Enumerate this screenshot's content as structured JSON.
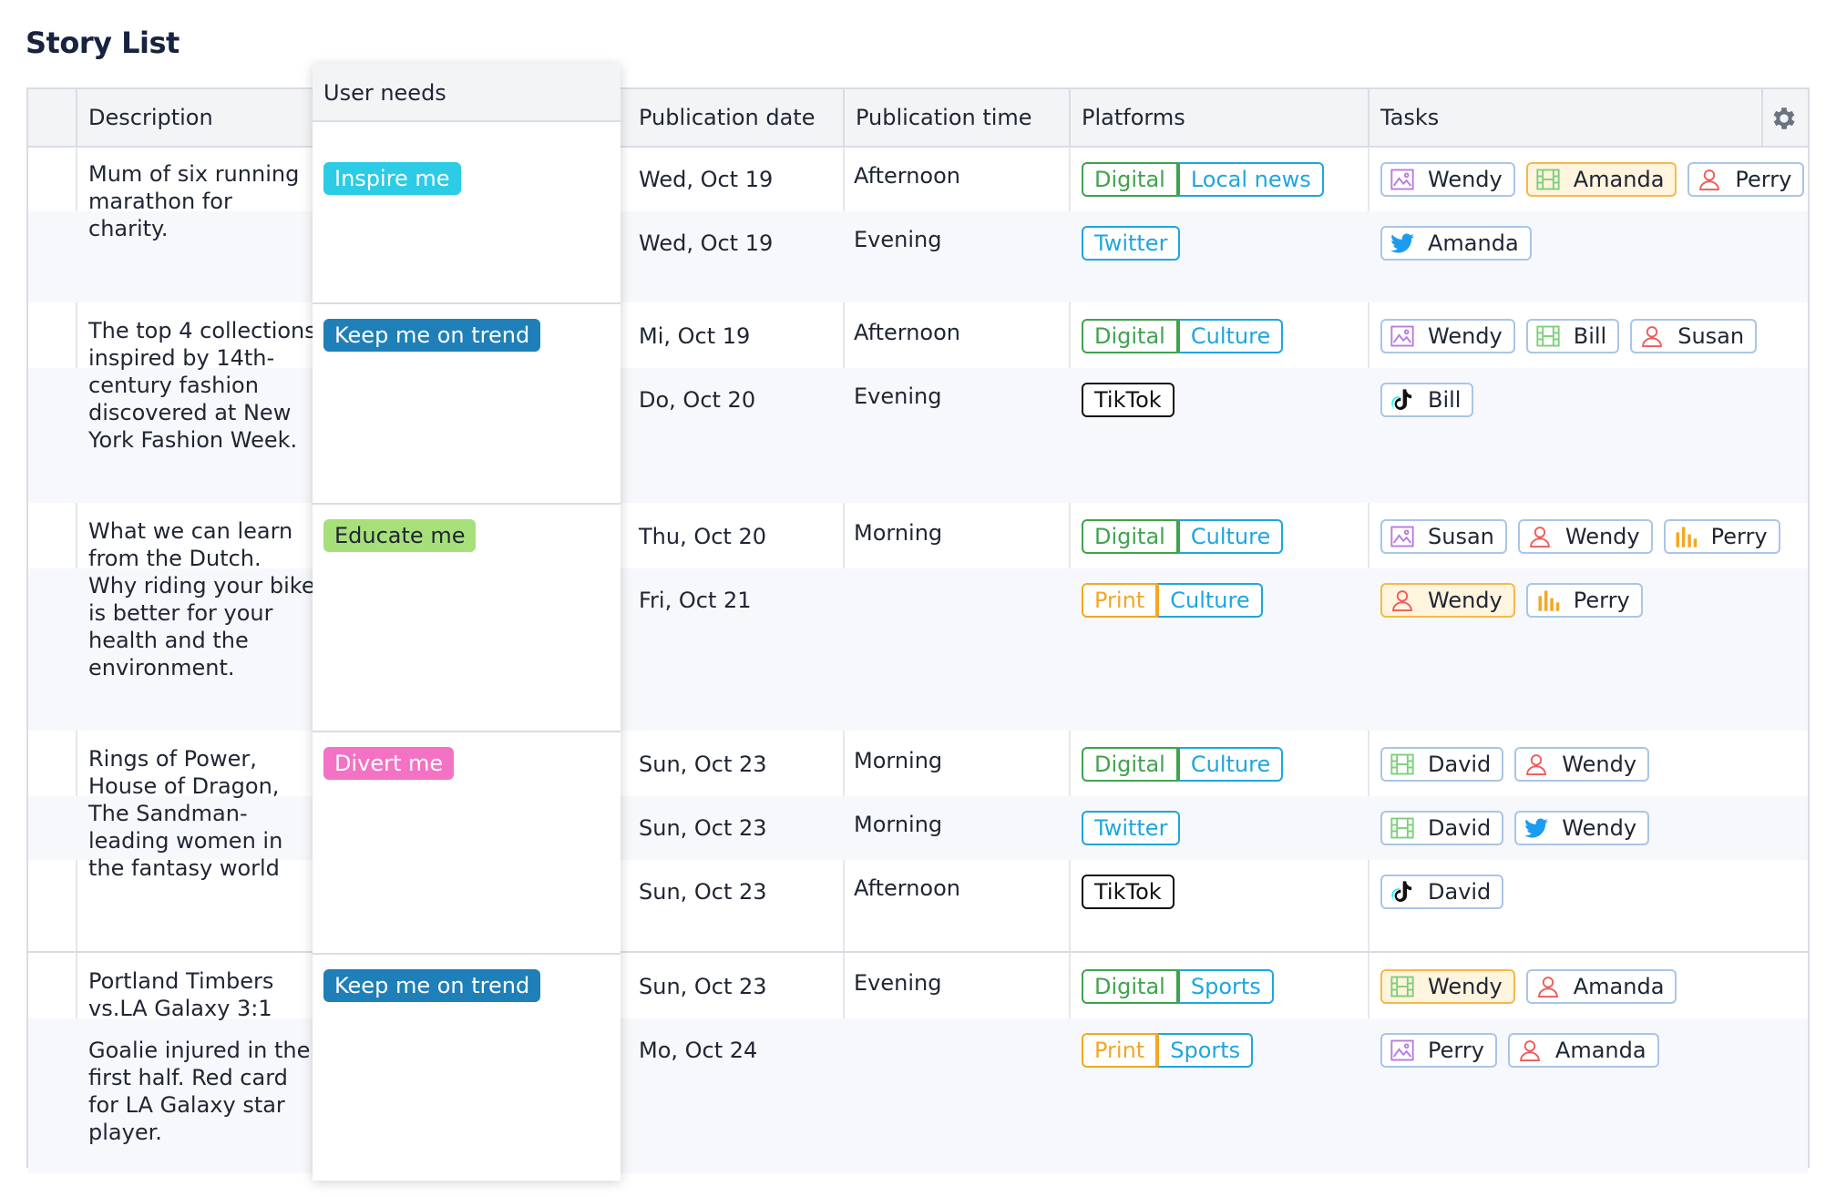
{
  "page_title": "Story List",
  "columns": {
    "description": "Description",
    "user_needs": "User needs",
    "publication_date": "Publication date",
    "publication_time": "Publication time",
    "platforms": "Platforms",
    "tasks": "Tasks"
  },
  "colors": {
    "digital": "#3fa34d",
    "print": "#f5a623",
    "section": "#1da6e0",
    "tiktok": "#111111",
    "inspire": "#2ccbe6",
    "trend": "#1f7fb8",
    "educate": "#a7e07a",
    "divert": "#f472c4"
  },
  "stories": [
    {
      "description": [
        "Mum of six running marathon for charity."
      ],
      "user_need": {
        "label": "Inspire me",
        "color": "#2ccbe6",
        "text_color": "#ffffff"
      },
      "publications": [
        {
          "date": "Wed, Oct 19",
          "time": "Afternoon",
          "platforms": [
            {
              "label": "Digital",
              "kind": "digital"
            },
            {
              "label": "Local news",
              "kind": "section"
            }
          ],
          "tasks": [
            {
              "name": "Wendy",
              "icon": "image-icon"
            },
            {
              "name": "Amanda",
              "icon": "film-icon",
              "highlight": true
            },
            {
              "name": "Perry",
              "icon": "person-icon"
            }
          ]
        },
        {
          "date": "Wed, Oct 19",
          "time": "Evening",
          "platforms": [
            {
              "label": "Twitter",
              "kind": "twitter"
            }
          ],
          "tasks": [
            {
              "name": "Amanda",
              "icon": "twitter-icon"
            }
          ]
        }
      ]
    },
    {
      "description": [
        "The top 4 collections inspired by 14th-century fashion discovered at New York Fashion Week."
      ],
      "user_need": {
        "label": "Keep me on trend",
        "color": "#1f7fb8",
        "text_color": "#ffffff"
      },
      "publications": [
        {
          "date": "Mi, Oct 19",
          "time": "Afternoon",
          "platforms": [
            {
              "label": "Digital",
              "kind": "digital"
            },
            {
              "label": "Culture",
              "kind": "section"
            }
          ],
          "tasks": [
            {
              "name": "Wendy",
              "icon": "image-icon"
            },
            {
              "name": "Bill",
              "icon": "film-icon"
            },
            {
              "name": "Susan",
              "icon": "person-icon"
            }
          ]
        },
        {
          "date": "Do, Oct 20",
          "time": "Evening",
          "platforms": [
            {
              "label": "TikTok",
              "kind": "tiktok"
            }
          ],
          "tasks": [
            {
              "name": "Bill",
              "icon": "tiktok-icon"
            }
          ]
        }
      ]
    },
    {
      "description": [
        "What we can learn from the Dutch. Why riding your bike is better for your health and the environment."
      ],
      "user_need": {
        "label": "Educate me",
        "color": "#a7e07a",
        "text_color": "#1f2533"
      },
      "publications": [
        {
          "date": "Thu, Oct 20",
          "time": "Morning",
          "platforms": [
            {
              "label": "Digital",
              "kind": "digital"
            },
            {
              "label": "Culture",
              "kind": "section"
            }
          ],
          "tasks": [
            {
              "name": "Susan",
              "icon": "image-icon"
            },
            {
              "name": "Wendy",
              "icon": "person-icon"
            },
            {
              "name": "Perry",
              "icon": "chart-icon"
            }
          ]
        },
        {
          "date": "Fri, Oct 21",
          "time": "",
          "platforms": [
            {
              "label": "Print",
              "kind": "print"
            },
            {
              "label": "Culture",
              "kind": "section"
            }
          ],
          "tasks": [
            {
              "name": "Wendy",
              "icon": "person-icon",
              "highlight": true
            },
            {
              "name": "Perry",
              "icon": "chart-icon"
            }
          ]
        }
      ]
    },
    {
      "description": [
        "Rings of Power, House of Dragon, The Sandman- leading women in the fantasy world"
      ],
      "user_need": {
        "label": "Divert me",
        "color": "#f472c4",
        "text_color": "#ffffff"
      },
      "publications": [
        {
          "date": "Sun, Oct 23",
          "time": "Morning",
          "platforms": [
            {
              "label": "Digital",
              "kind": "digital"
            },
            {
              "label": "Culture",
              "kind": "section"
            }
          ],
          "tasks": [
            {
              "name": "David",
              "icon": "film-icon"
            },
            {
              "name": "Wendy",
              "icon": "person-icon"
            }
          ]
        },
        {
          "date": "Sun, Oct 23",
          "time": "Morning",
          "platforms": [
            {
              "label": "Twitter",
              "kind": "twitter"
            }
          ],
          "tasks": [
            {
              "name": "David",
              "icon": "film-icon"
            },
            {
              "name": "Wendy",
              "icon": "twitter-icon"
            }
          ]
        },
        {
          "date": "Sun, Oct 23",
          "time": "Afternoon",
          "platforms": [
            {
              "label": "TikTok",
              "kind": "tiktok"
            }
          ],
          "tasks": [
            {
              "name": "David",
              "icon": "tiktok-icon"
            }
          ]
        }
      ]
    },
    {
      "description": [
        "Portland Timbers vs.LA Galaxy 3:1",
        "Goalie injured in the first half. Red card for LA Galaxy star player."
      ],
      "user_need": {
        "label": "Keep me on trend",
        "color": "#1f7fb8",
        "text_color": "#ffffff"
      },
      "publications": [
        {
          "date": "Sun, Oct 23",
          "time": "Evening",
          "platforms": [
            {
              "label": "Digital",
              "kind": "digital"
            },
            {
              "label": "Sports",
              "kind": "section"
            }
          ],
          "tasks": [
            {
              "name": "Wendy",
              "icon": "film-icon",
              "highlight": true
            },
            {
              "name": "Amanda",
              "icon": "person-icon"
            }
          ]
        },
        {
          "date": "Mo, Oct 24",
          "time": "",
          "platforms": [
            {
              "label": "Print",
              "kind": "print"
            },
            {
              "label": "Sports",
              "kind": "section"
            }
          ],
          "tasks": [
            {
              "name": "Perry",
              "icon": "image-icon"
            },
            {
              "name": "Amanda",
              "icon": "person-icon"
            }
          ]
        }
      ]
    }
  ]
}
